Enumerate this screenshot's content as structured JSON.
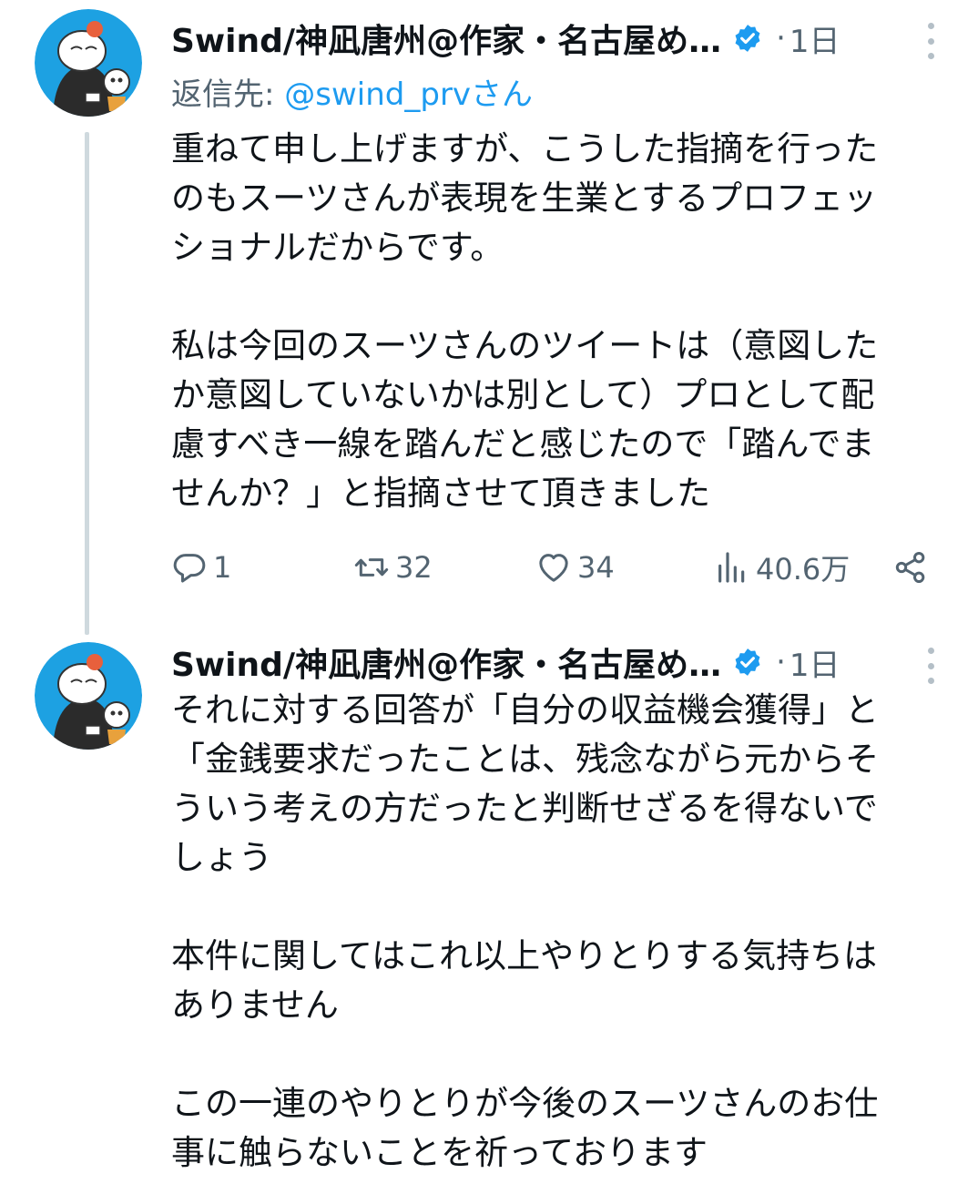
{
  "tweets": [
    {
      "display_name": "Swind/神凪唐州@作家・名古屋め…",
      "dot": "·",
      "time": "1日",
      "reply_prefix": "返信先: ",
      "reply_handle": "@swind_prvさん",
      "text": "重ねて申し上げますが、こうした指摘を行った\nのもスーツさんが表現を生業とするプロフェッ\nショナルだからです。\n\n私は今回のスーツさんのツイートは（意図した\nか意図していないかは別として）プロとして配\n慮すべき一線を踏んだと感じたので「踏んでま\nせんか？」と指摘させて頂きました",
      "replies": "1",
      "retweets": "32",
      "likes": "34",
      "views": "40.6万"
    },
    {
      "display_name": "Swind/神凪唐州@作家・名古屋め…",
      "dot": "·",
      "time": "1日",
      "text": "それに対する回答が「自分の収益機会獲得」と\n「金銭要求だったことは、残念ながら元からそ\nういう考えの方だったと判断せざるを得ないで\nしょう\n\n本件に関してはこれ以上やりとりする気持ちは\nありません\n\nこの一連のやりとりが今後のスーツさんのお仕\n事に触らないことを祈っております"
    }
  ],
  "colors": {
    "verified_badge": "#1d9bf0",
    "link": "#1d9bf0",
    "secondary_text": "#536471",
    "avatar_background": "#1da1e2"
  },
  "icons": [
    "verified-badge-icon",
    "more-options-icon",
    "reply-icon",
    "retweet-icon",
    "like-icon",
    "views-icon",
    "share-icon"
  ]
}
